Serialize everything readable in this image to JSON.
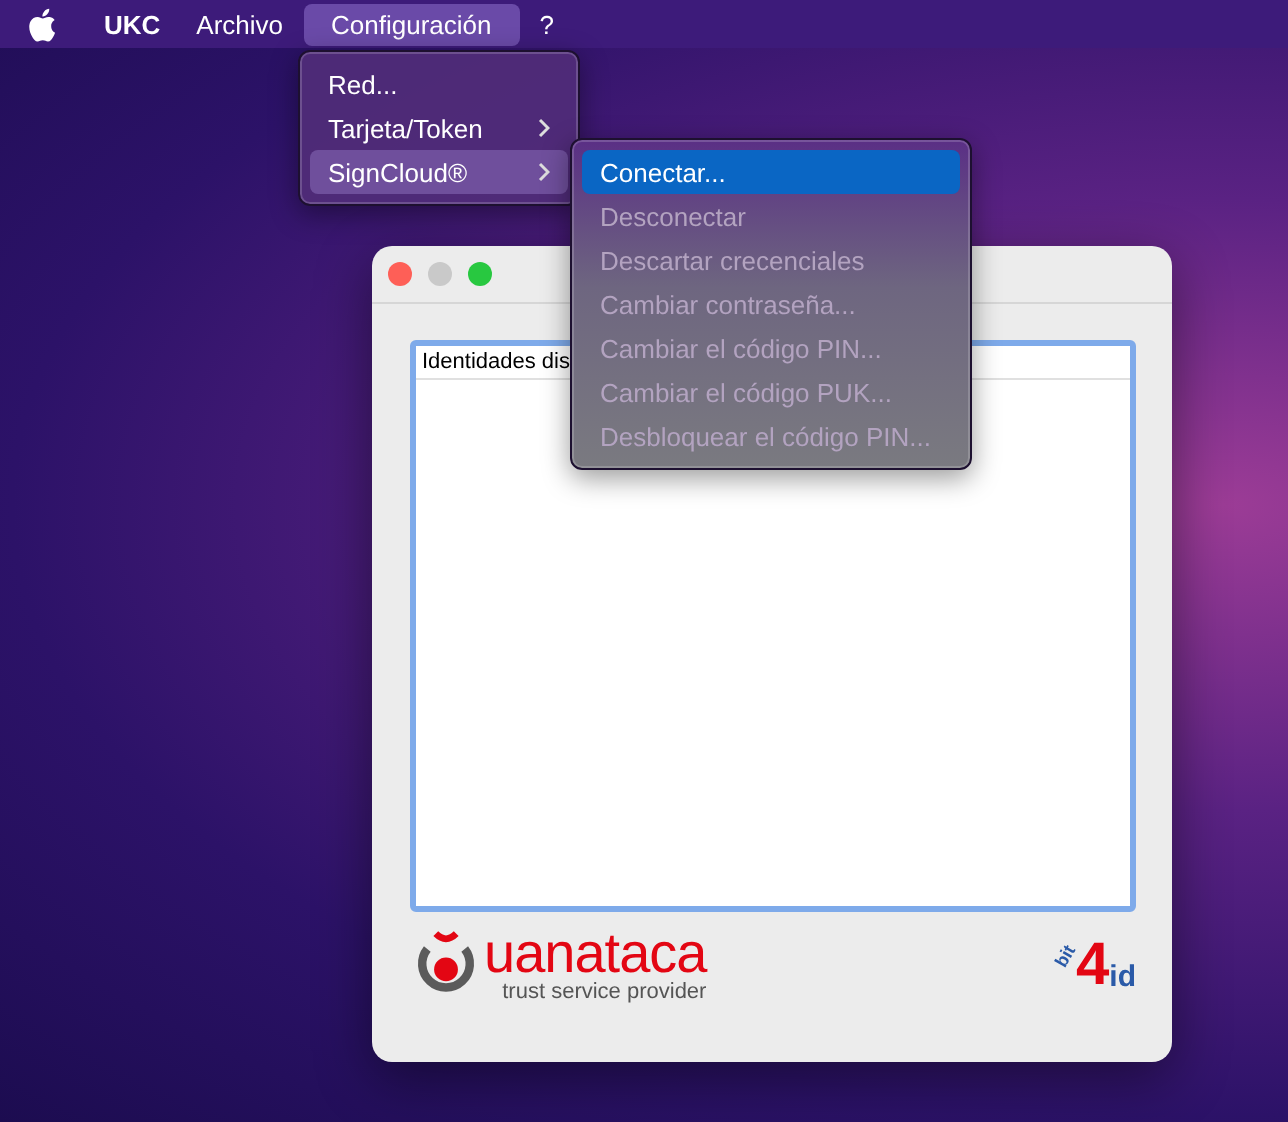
{
  "menubar": {
    "items": [
      {
        "label": "UKC",
        "kind": "app",
        "selected": false
      },
      {
        "label": "Archivo",
        "kind": "menu",
        "selected": false
      },
      {
        "label": "Configuración",
        "kind": "menu",
        "selected": true
      },
      {
        "label": "?",
        "kind": "menu",
        "selected": false
      }
    ]
  },
  "config_menu": {
    "items": [
      {
        "label": "Red...",
        "submenu": false,
        "selected": false
      },
      {
        "label": "Tarjeta/Token",
        "submenu": true,
        "selected": false
      },
      {
        "label": "SignCloud®",
        "submenu": true,
        "selected": true
      }
    ]
  },
  "signcloud_menu": {
    "items": [
      {
        "label": "Conectar...",
        "disabled": false,
        "selected": true
      },
      {
        "label": "Desconectar",
        "disabled": true,
        "selected": false
      },
      {
        "label": "Descartar crecenciales",
        "disabled": true,
        "selected": false
      },
      {
        "label": "Cambiar contraseña...",
        "disabled": true,
        "selected": false
      },
      {
        "label": "Cambiar el código PIN...",
        "disabled": true,
        "selected": false
      },
      {
        "label": "Cambiar el código PUK...",
        "disabled": true,
        "selected": false
      },
      {
        "label": "Desbloquear el código PIN...",
        "disabled": true,
        "selected": false
      }
    ]
  },
  "window": {
    "list": {
      "header": "Identidades dis"
    },
    "logos": {
      "uanataca": {
        "name": "uanataca",
        "tagline": "trust service provider"
      },
      "bit4id": {
        "small": "bit",
        "digit": "4",
        "suffix": "id"
      }
    }
  }
}
